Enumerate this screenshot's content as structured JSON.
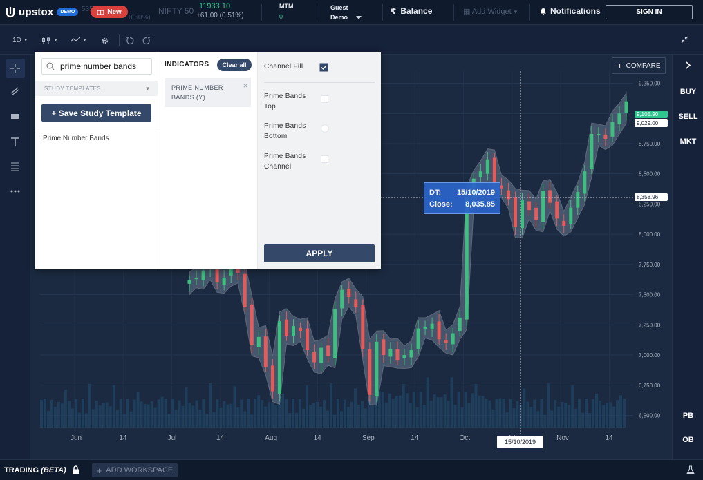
{
  "header": {
    "brand": "upstox",
    "demo_badge": "DEMO",
    "ghost_ticker_price": "53530.98",
    "ghost_ticker_change": "0.60%)",
    "new_label": "New",
    "index_name": "NIFTY 50",
    "index_value": "11933.10",
    "index_change": "+61.00 (0.51%)",
    "mtm_label": "MTM",
    "mtm_value": "0",
    "user_line1": "Guest",
    "user_line2": "Demo",
    "balance_label": "Balance",
    "add_widget_label": "Add Widget",
    "notifications_label": "Notifications",
    "signin_label": "SIGN IN"
  },
  "toolbar": {
    "interval": "1D"
  },
  "compare_label": "COMPARE",
  "right_rail": {
    "buy": "BUY",
    "sell": "SELL",
    "mkt": "MKT",
    "pb": "PB",
    "ob": "OB"
  },
  "study_modal": {
    "search_value": "prime number bands",
    "study_templates_label": "STUDY TEMPLATES",
    "save_template_label": "+ Save Study Template",
    "study_list": [
      "Prime Number Bands"
    ],
    "indicators_title": "INDICATORS",
    "clear_all_label": "Clear all",
    "active_indicator": "PRIME NUMBER BANDS (Y)",
    "options": [
      {
        "label": "Channel Fill",
        "control": "checkbox",
        "checked": true
      },
      {
        "label": "Prime Bands Top",
        "control": "checkbox",
        "checked": false
      },
      {
        "label": "Prime Bands Bottom",
        "control": "radio",
        "checked": false
      },
      {
        "label": "Prime Bands Channel",
        "control": "checkbox",
        "checked": false
      }
    ],
    "apply_label": "APPLY"
  },
  "tooltip": {
    "dt_label": "DT:",
    "dt_value": "15/10/2019",
    "close_label": "Close:",
    "close_value": "8,035.85"
  },
  "crosshair_date": "15/10/2019",
  "price_tags": {
    "last_up": "9,105.90",
    "last": "9,029.00",
    "crosshair": "8,358.96"
  },
  "footer": {
    "trading_label": "TRADING",
    "beta_label": "(BETA)",
    "add_workspace_label": "ADD WORKSPACE"
  },
  "chart_data": {
    "type": "candlestick",
    "y_ticks": [
      "9,250.00",
      "9,000.00",
      "8,750.00",
      "8,500.00",
      "8,250.00",
      "8,000.00",
      "7,750.00",
      "7,500.00",
      "7,250.00",
      "7,000.00",
      "6,750.00",
      "6,500.00"
    ],
    "ylim": [
      6400,
      9350
    ],
    "x_ticks": [
      "Jun",
      "14",
      "Jul",
      "14",
      "Aug",
      "14",
      "Sep",
      "14",
      "Oct",
      "14",
      "Nov",
      "14"
    ],
    "close_series": [
      7620,
      7640,
      7700,
      7770,
      7600,
      7640,
      7720,
      7680,
      7400,
      7080,
      7150,
      6900,
      6700,
      7280,
      7160,
      7240,
      7200,
      7040,
      6940,
      7060,
      6990,
      7380,
      7540,
      7480,
      7400,
      7050,
      6670,
      7110,
      7000,
      7050,
      6960,
      7000,
      7040,
      7220,
      7230,
      7260,
      7130,
      7100,
      7180,
      7310,
      8310,
      8460,
      8520,
      8620,
      8400,
      8380,
      8290,
      8060,
      8280,
      8200,
      8120,
      8360,
      8260,
      8130,
      8070,
      8220,
      8350,
      8520,
      8830,
      8830,
      8790,
      8930,
      9000,
      9100
    ],
    "up_color": "#3fbf7f",
    "down_color": "#e35b5b",
    "band_fill": "#9fb0c7"
  },
  "colors": {
    "accent": "#34486a",
    "green": "#2ec58f",
    "red": "#d9413d",
    "blue_tooltip": "#2a64c8"
  }
}
